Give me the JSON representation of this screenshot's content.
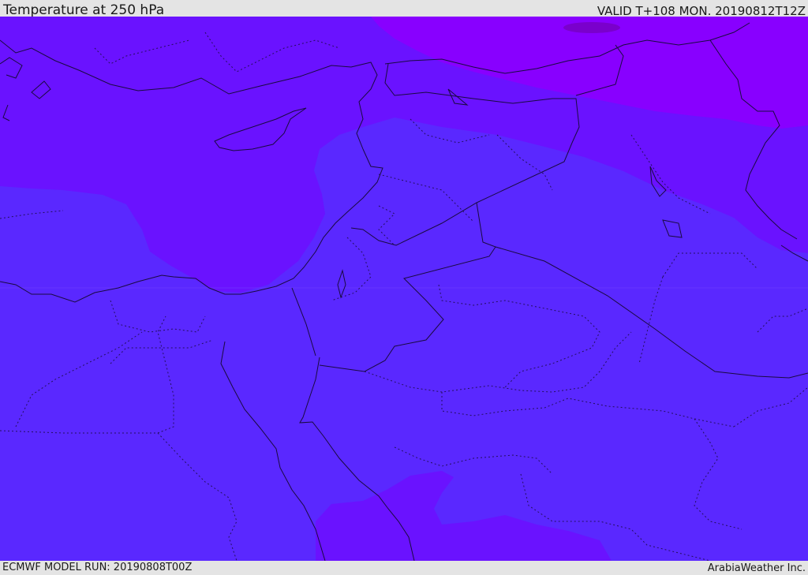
{
  "header": {
    "title": "Temperature at 250 hPa",
    "valid": "VALID T+108 MON. 20190812T12Z"
  },
  "footer": {
    "model_run": "ECMWF MODEL RUN: 20190808T00Z",
    "credit": "ArabiaWeather Inc."
  },
  "colors": {
    "bar_background": "#e4e4e4",
    "text": "#1a1a1a",
    "band_cold": "#8800ff",
    "band_mid": "#6a12ff",
    "band_warm": "#5a28ff",
    "coastline": "#1a0a40"
  },
  "map": {
    "region": "Eastern Mediterranean, Levant, Egypt, Arabian Peninsula, Iraq",
    "field": "temperature",
    "level": "250 hPa"
  }
}
